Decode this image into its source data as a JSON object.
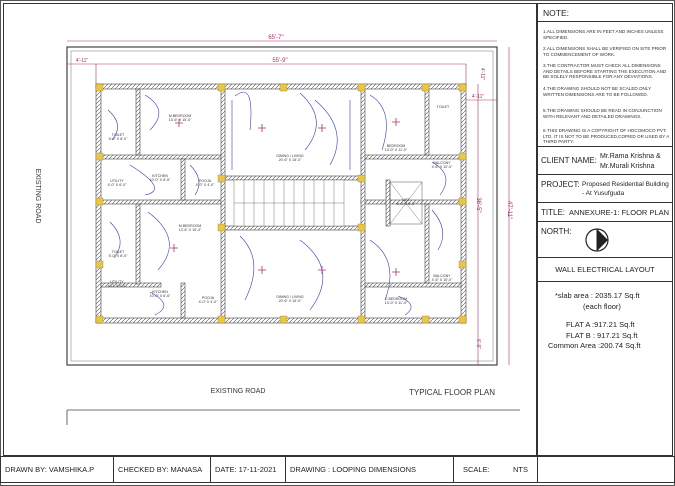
{
  "dimensions": {
    "overall_width": "65'-7\"",
    "inner_width": "55'-9\"",
    "left_offset": "4'-11\"",
    "right_offset_top": "4'-11\"",
    "right_offset_mid": "4'-11\"",
    "right_depth": "47'-11\"",
    "right_depth_inner": "36'-5\"",
    "right_bottom": "6'-9\""
  },
  "road_left": "EXISTING ROAD",
  "road_bottom": "EXISTING ROAD",
  "plan_caption": "TYPICAL FLOOR PLAN",
  "rooms": {
    "toilet_1": "TOILET",
    "toilet_1_size": "5'-0\" X 8'-0\"",
    "master_bed_1": "M.BEDROOM",
    "master_bed_1_size": "13'-6\" X 15'-0\"",
    "dining_1": "DINING / LIVING",
    "dining_1_size": "20'-6\" X 15'-0\"",
    "bedroom_1": "BEDROOM",
    "bedroom_1_size": "13'-0\" X 11'-0\"",
    "toilet_2": "TOILET",
    "balcony_1": "BALCONY",
    "balcony_1_size": "4'-6\" X 10'-0\"",
    "utility_1": "UTILITY",
    "utility_1_size": "4'-0\" X 6'-0\"",
    "kitchen_1": "KITCHEN",
    "kitchen_1_size": "10'-0\" X 6'-6\"",
    "pooja_1": "POOJA",
    "pooja_1_size": "4'-0\" X 4'-0\"",
    "lift": "LIFT",
    "lift_size": "6'-0\" X 6'-0\"",
    "master_bed_2": "M.BEDROOM",
    "master_bed_2_size": "13'-6\" X 15'-0\"",
    "dining_2": "DINING / LIVING",
    "dining_2_size": "20'-6\" X 15'-0\"",
    "toilet_3": "TOILET",
    "toilet_3_size": "5'-0\" X 8'-0\"",
    "balcony_2": "BALCONY",
    "balcony_2_size": "4'-6\" X 10'-0\"",
    "utility_2": "UTILITY",
    "utility_2_size": "4'-0\" X 6'-0\"",
    "kitchen_2": "KITCHEN",
    "kitchen_2_size": "10'-0\" X 6'-6\"",
    "pooja_2": "POOJA",
    "pooja_2_size": "4'-0\" X 4'-0\"",
    "bedroom_2": "C.BEDROOM",
    "bedroom_2_size": "13'-0\" X 11'-0\""
  },
  "sidebar": {
    "note_title": "NOTE:",
    "notes": [
      "1.ALL DIMENSIONS ARE IN FEET AND INCHES UNLESS SPECIFIED.",
      "2.ALL DIMENSIONS SHALL BE VERIFIED ON SITE PRIOR TO COMMENCEMENT OF WORK.",
      "3.THE CONTRACTOR MUST CHECK ALL DIMENSIONS AND DETAILS BEFORE STARTING THE EXECUTION AND BE SOLELY RESPONSIBLE FOR ANY DEVIATIONS.",
      "4.THE DRAWING SHOULD NOT BE SCALED.ONLY WRITTEN DIMENSIONS ARE TO BE FOLLOWED.",
      "5.THE DRAWING SHOULD BE READ IN CONJUNCTION WITH RELEVANT AND DETAILED DRAWINGS.",
      "6.THIS DRAWING IS A COPYRIGHT OF HOCOMOCO PVT. LTD. IT IS NOT TO BE PRODUCED,COPIED OR USED BY A THIRD PARTY."
    ],
    "client_label": "CLIENT NAME:",
    "client_name_1": "Mr.Rama Krishna &",
    "client_name_2": "Mr.Murali Krishna",
    "project_label": "PROJECT:",
    "project_1": "Proposed Residential Building",
    "project_2": "- At Yusufguda",
    "title_label": "TITLE:",
    "title_value": "ANNEXURE-1: FLOOR PLAN",
    "north_label": "NORTH:",
    "layout_title": "WALL ELECTRICAL LAYOUT",
    "area_1": "*slab area : 2035.17 Sq.ft",
    "area_2": "(each floor)",
    "area_3": "FLAT A :917.21 Sq.ft",
    "area_4": "FLAT B : 917.21 Sq.ft",
    "area_5": "Common Area :200.74 Sq.ft"
  },
  "footer": {
    "drawn_by": "DRAWN BY:  VAMSHIKA.P",
    "checked_by": "CHECKED BY: MANASA",
    "date": "DATE:  17-11-2021",
    "drawing": "DRAWING : LOOPING DIMENSIONS",
    "scale_label": "SCALE:",
    "scale_value": "NTS"
  }
}
